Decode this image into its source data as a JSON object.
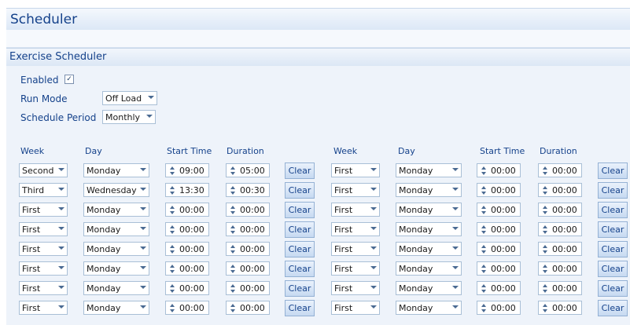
{
  "app": {
    "title": "Scheduler"
  },
  "section": {
    "title": "Exercise Scheduler"
  },
  "settings": {
    "enabled_label": "Enabled",
    "enabled_checked": true,
    "run_mode_label": "Run Mode",
    "run_mode_value": "Off Load",
    "period_label": "Schedule Period",
    "period_value": "Monthly"
  },
  "columns": {
    "week": "Week",
    "day": "Day",
    "start": "Start Time",
    "duration": "Duration"
  },
  "clear_label": "Clear",
  "left_rows": [
    {
      "week": "Second",
      "day": "Monday",
      "start": "09:00",
      "duration": "05:00"
    },
    {
      "week": "Third",
      "day": "Wednesday",
      "start": "13:30",
      "duration": "00:30"
    },
    {
      "week": "First",
      "day": "Monday",
      "start": "00:00",
      "duration": "00:00"
    },
    {
      "week": "First",
      "day": "Monday",
      "start": "00:00",
      "duration": "00:00"
    },
    {
      "week": "First",
      "day": "Monday",
      "start": "00:00",
      "duration": "00:00"
    },
    {
      "week": "First",
      "day": "Monday",
      "start": "00:00",
      "duration": "00:00"
    },
    {
      "week": "First",
      "day": "Monday",
      "start": "00:00",
      "duration": "00:00"
    },
    {
      "week": "First",
      "day": "Monday",
      "start": "00:00",
      "duration": "00:00"
    }
  ],
  "right_rows": [
    {
      "week": "First",
      "day": "Monday",
      "start": "00:00",
      "duration": "00:00"
    },
    {
      "week": "First",
      "day": "Monday",
      "start": "00:00",
      "duration": "00:00"
    },
    {
      "week": "First",
      "day": "Monday",
      "start": "00:00",
      "duration": "00:00"
    },
    {
      "week": "First",
      "day": "Monday",
      "start": "00:00",
      "duration": "00:00"
    },
    {
      "week": "First",
      "day": "Monday",
      "start": "00:00",
      "duration": "00:00"
    },
    {
      "week": "First",
      "day": "Monday",
      "start": "00:00",
      "duration": "00:00"
    },
    {
      "week": "First",
      "day": "Monday",
      "start": "00:00",
      "duration": "00:00"
    },
    {
      "week": "First",
      "day": "Monday",
      "start": "00:00",
      "duration": "00:00"
    }
  ]
}
